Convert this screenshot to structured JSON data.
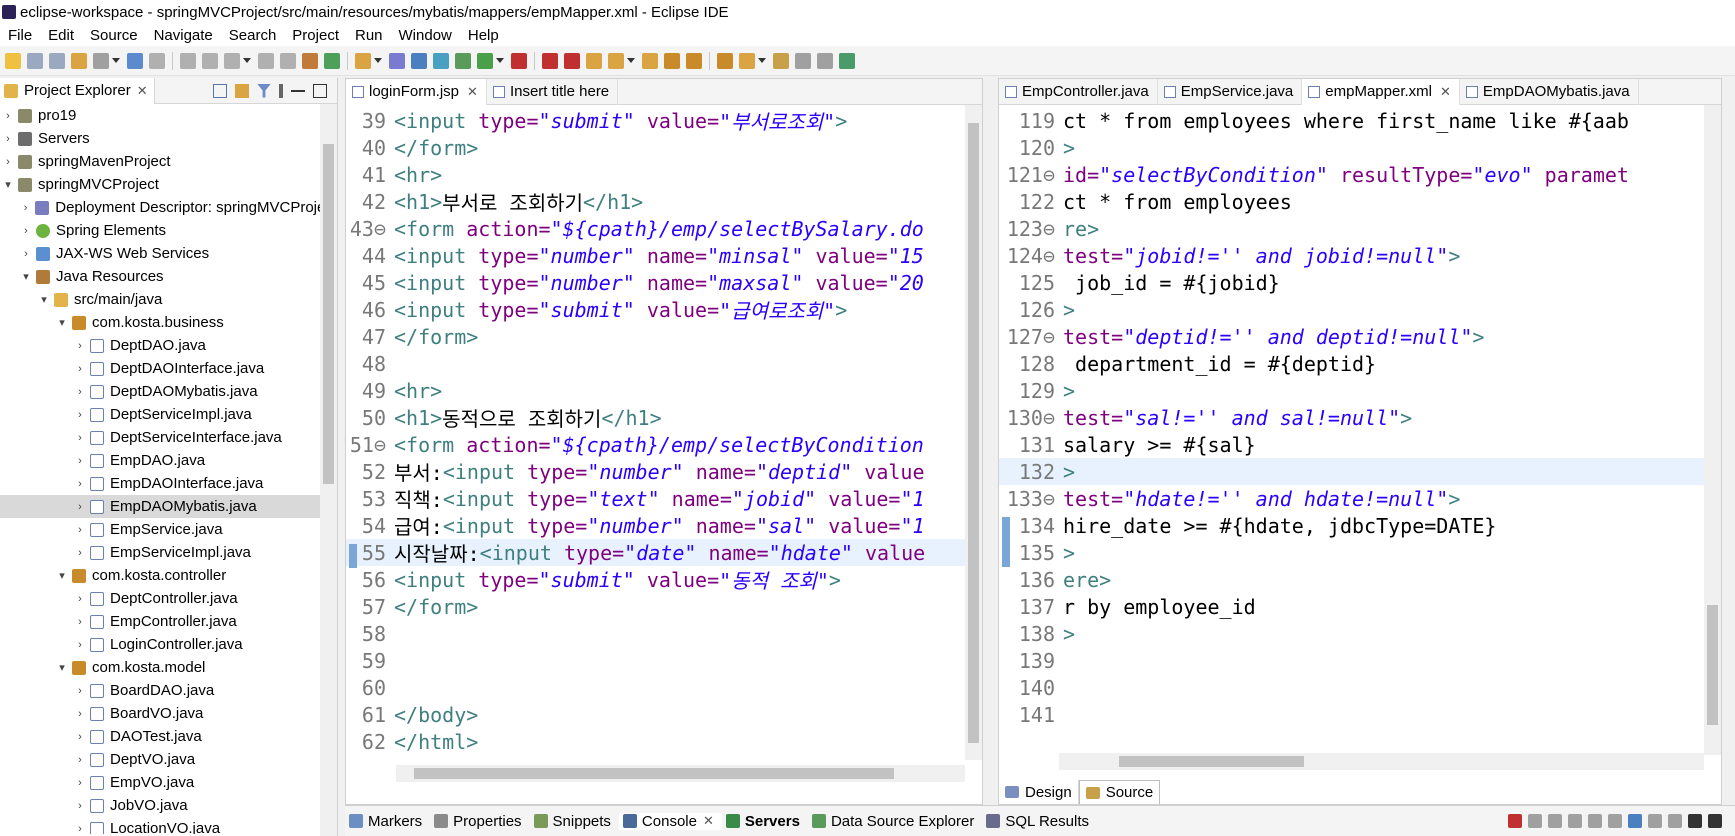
{
  "window": {
    "title": "eclipse-workspace - springMVCProject/src/main/resources/mybatis/mappers/empMapper.xml - Eclipse IDE"
  },
  "menu": [
    "File",
    "Edit",
    "Source",
    "Navigate",
    "Search",
    "Project",
    "Run",
    "Window",
    "Help"
  ],
  "project_explorer": {
    "tab_label": "Project Explorer",
    "items": [
      {
        "label": "pro19",
        "icon": "project-icon",
        "depth": 0,
        "chev": "›"
      },
      {
        "label": "Servers",
        "icon": "folder-icon",
        "depth": 0,
        "chev": "›"
      },
      {
        "label": "springMavenProject",
        "icon": "project-icon",
        "depth": 0,
        "chev": "›"
      },
      {
        "label": "springMVCProject",
        "icon": "project-icon",
        "depth": 0,
        "chev": "⌄"
      },
      {
        "label": "Deployment Descriptor: springMVCProject",
        "icon": "deployment-descriptor-icon",
        "depth": 1,
        "chev": "›"
      },
      {
        "label": "Spring Elements",
        "icon": "spring-icon",
        "depth": 1,
        "chev": "›"
      },
      {
        "label": "JAX-WS Web Services",
        "icon": "webservice-icon",
        "depth": 1,
        "chev": "›"
      },
      {
        "label": "Java Resources",
        "icon": "java-resources-icon",
        "depth": 1,
        "chev": "⌄"
      },
      {
        "label": "src/main/java",
        "icon": "source-folder-icon",
        "depth": 2,
        "chev": "⌄"
      },
      {
        "label": "com.kosta.business",
        "icon": "package-icon",
        "depth": 3,
        "chev": "⌄"
      },
      {
        "label": "DeptDAO.java",
        "icon": "java-file-icon",
        "depth": 4,
        "chev": "›"
      },
      {
        "label": "DeptDAOInterface.java",
        "icon": "java-file-icon",
        "depth": 4,
        "chev": "›"
      },
      {
        "label": "DeptDAOMybatis.java",
        "icon": "java-file-icon",
        "depth": 4,
        "chev": "›"
      },
      {
        "label": "DeptServiceImpl.java",
        "icon": "java-file-icon",
        "depth": 4,
        "chev": "›"
      },
      {
        "label": "DeptServiceInterface.java",
        "icon": "java-file-icon",
        "depth": 4,
        "chev": "›"
      },
      {
        "label": "EmpDAO.java",
        "icon": "java-file-icon",
        "depth": 4,
        "chev": "›"
      },
      {
        "label": "EmpDAOInterface.java",
        "icon": "java-file-icon",
        "depth": 4,
        "chev": "›"
      },
      {
        "label": "EmpDAOMybatis.java",
        "icon": "java-file-icon",
        "depth": 4,
        "chev": "›",
        "selected": true
      },
      {
        "label": "EmpService.java",
        "icon": "java-file-icon",
        "depth": 4,
        "chev": "›"
      },
      {
        "label": "EmpServiceImpl.java",
        "icon": "java-file-icon",
        "depth": 4,
        "chev": "›"
      },
      {
        "label": "com.kosta.controller",
        "icon": "package-icon",
        "depth": 3,
        "chev": "⌄"
      },
      {
        "label": "DeptController.java",
        "icon": "java-file-icon",
        "depth": 4,
        "chev": "›"
      },
      {
        "label": "EmpController.java",
        "icon": "java-file-icon",
        "depth": 4,
        "chev": "›"
      },
      {
        "label": "LoginController.java",
        "icon": "java-file-icon",
        "depth": 4,
        "chev": "›"
      },
      {
        "label": "com.kosta.model",
        "icon": "package-icon",
        "depth": 3,
        "chev": "⌄"
      },
      {
        "label": "BoardDAO.java",
        "icon": "java-file-icon",
        "depth": 4,
        "chev": "›"
      },
      {
        "label": "BoardVO.java",
        "icon": "java-file-icon",
        "depth": 4,
        "chev": "›"
      },
      {
        "label": "DAOTest.java",
        "icon": "java-file-icon",
        "depth": 4,
        "chev": "›"
      },
      {
        "label": "DeptVO.java",
        "icon": "java-file-icon",
        "depth": 4,
        "chev": "›"
      },
      {
        "label": "EmpVO.java",
        "icon": "java-file-icon",
        "depth": 4,
        "chev": "›"
      },
      {
        "label": "JobVO.java",
        "icon": "java-file-icon",
        "depth": 4,
        "chev": "›"
      },
      {
        "label": "LocationVO.java",
        "icon": "java-file-icon",
        "depth": 4,
        "chev": "›"
      }
    ]
  },
  "left_editor": {
    "tabs": [
      {
        "label": "loginForm.jsp",
        "active": true,
        "closable": true
      },
      {
        "label": "Insert title here",
        "active": false,
        "closable": false
      }
    ],
    "lines": [
      {
        "n": "39",
        "tokens": [
          [
            "tag",
            "<input "
          ],
          [
            "attr",
            "type="
          ],
          [
            "str",
            "\"submit\""
          ],
          [
            "attr",
            " value="
          ],
          [
            "str",
            "\"부서로조회\""
          ],
          [
            "tag",
            ">"
          ]
        ]
      },
      {
        "n": "40",
        "tokens": [
          [
            "tag",
            "</form>"
          ]
        ]
      },
      {
        "n": "41",
        "tokens": [
          [
            "tag",
            "<hr>"
          ]
        ]
      },
      {
        "n": "42",
        "tokens": [
          [
            "tag",
            "<h1>"
          ],
          [
            "txt",
            "부서로 조회하기"
          ],
          [
            "tag",
            "</h1>"
          ]
        ]
      },
      {
        "n": "43⊖",
        "tokens": [
          [
            "tag",
            "<form "
          ],
          [
            "attr",
            "action="
          ],
          [
            "str",
            "\"${cpath}/emp/selectBySalary.do"
          ]
        ]
      },
      {
        "n": "44",
        "tokens": [
          [
            "tag",
            "<input "
          ],
          [
            "attr",
            "type="
          ],
          [
            "str",
            "\"number\""
          ],
          [
            "attr",
            " name="
          ],
          [
            "str",
            "\"minsal\""
          ],
          [
            "attr",
            " value="
          ],
          [
            "str",
            "\"15"
          ]
        ]
      },
      {
        "n": "45",
        "tokens": [
          [
            "tag",
            "<input "
          ],
          [
            "attr",
            "type="
          ],
          [
            "str",
            "\"number\""
          ],
          [
            "attr",
            " name="
          ],
          [
            "str",
            "\"maxsal\""
          ],
          [
            "attr",
            " value="
          ],
          [
            "str",
            "\"20"
          ]
        ]
      },
      {
        "n": "46",
        "tokens": [
          [
            "tag",
            "<input "
          ],
          [
            "attr",
            "type="
          ],
          [
            "str",
            "\"submit\""
          ],
          [
            "attr",
            " value="
          ],
          [
            "str",
            "\"급여로조회\""
          ],
          [
            "tag",
            ">"
          ]
        ]
      },
      {
        "n": "47",
        "tokens": [
          [
            "tag",
            "</form>"
          ]
        ]
      },
      {
        "n": "48",
        "tokens": []
      },
      {
        "n": "49",
        "tokens": [
          [
            "tag",
            "<hr>"
          ]
        ]
      },
      {
        "n": "50",
        "tokens": [
          [
            "tag",
            "<h1>"
          ],
          [
            "txt",
            "동적으로 조회하기"
          ],
          [
            "tag",
            "</h1>"
          ]
        ]
      },
      {
        "n": "51⊖",
        "tokens": [
          [
            "tag",
            "<form "
          ],
          [
            "attr",
            "action="
          ],
          [
            "str",
            "\"${cpath}/emp/selectByCondition"
          ]
        ]
      },
      {
        "n": "52",
        "tokens": [
          [
            "txt",
            "부서:"
          ],
          [
            "tag",
            "<input "
          ],
          [
            "attr",
            "type="
          ],
          [
            "str",
            "\"number\""
          ],
          [
            "attr",
            " name="
          ],
          [
            "str",
            "\"deptid\""
          ],
          [
            "attr",
            " value"
          ]
        ]
      },
      {
        "n": "53",
        "tokens": [
          [
            "txt",
            "직책:"
          ],
          [
            "tag",
            "<input "
          ],
          [
            "attr",
            "type="
          ],
          [
            "str",
            "\"text\""
          ],
          [
            "attr",
            " name="
          ],
          [
            "str",
            "\"jobid\""
          ],
          [
            "attr",
            " value="
          ],
          [
            "str",
            "\"1"
          ]
        ]
      },
      {
        "n": "54",
        "tokens": [
          [
            "txt",
            "급여:"
          ],
          [
            "tag",
            "<input "
          ],
          [
            "attr",
            "type="
          ],
          [
            "str",
            "\"number\""
          ],
          [
            "attr",
            " name="
          ],
          [
            "str",
            "\"sal\""
          ],
          [
            "attr",
            " value="
          ],
          [
            "str",
            "\"1"
          ]
        ]
      },
      {
        "n": "55",
        "tokens": [
          [
            "txt",
            "시작날짜:"
          ],
          [
            "tag",
            "<input "
          ],
          [
            "attr",
            "type="
          ],
          [
            "str",
            "\"date\""
          ],
          [
            "attr",
            " name="
          ],
          [
            "str",
            "\"hdate\""
          ],
          [
            "attr",
            " value"
          ]
        ],
        "current": true
      },
      {
        "n": "56",
        "tokens": [
          [
            "tag",
            "<input "
          ],
          [
            "attr",
            "type="
          ],
          [
            "str",
            "\"submit\""
          ],
          [
            "attr",
            " value="
          ],
          [
            "str",
            "\"동적 조회\""
          ],
          [
            "tag",
            ">"
          ]
        ]
      },
      {
        "n": "57",
        "tokens": [
          [
            "tag",
            "</form>"
          ]
        ]
      },
      {
        "n": "58",
        "tokens": []
      },
      {
        "n": "59",
        "tokens": []
      },
      {
        "n": "60",
        "tokens": []
      },
      {
        "n": "61",
        "tokens": [
          [
            "tag",
            "</body>"
          ]
        ]
      },
      {
        "n": "62",
        "tokens": [
          [
            "tag",
            "</html>"
          ]
        ]
      }
    ]
  },
  "right_editor": {
    "tabs": [
      {
        "label": "EmpController.java",
        "active": false,
        "closable": false
      },
      {
        "label": "EmpService.java",
        "active": false,
        "closable": false
      },
      {
        "label": "empMapper.xml",
        "active": true,
        "closable": true
      },
      {
        "label": "EmpDAOMybatis.java",
        "active": false,
        "closable": false
      }
    ],
    "lines": [
      {
        "n": "119",
        "tokens": [
          [
            "txt",
            "ct * from employees where first_name like #{aab"
          ]
        ]
      },
      {
        "n": "120",
        "tokens": [
          [
            "tag",
            ">"
          ]
        ]
      },
      {
        "n": "121⊖",
        "tokens": [
          [
            "attr",
            "id="
          ],
          [
            "str",
            "\"selectByCondition\""
          ],
          [
            "attr",
            " resultType="
          ],
          [
            "str",
            "\"evo\""
          ],
          [
            "attr",
            " paramet"
          ]
        ]
      },
      {
        "n": "122",
        "tokens": [
          [
            "txt",
            "ct * from employees"
          ]
        ]
      },
      {
        "n": "123⊖",
        "tokens": [
          [
            "tag",
            "re>"
          ]
        ]
      },
      {
        "n": "124⊖",
        "tokens": [
          [
            "attr",
            "test="
          ],
          [
            "str",
            "\"jobid!='' and jobid!=null\""
          ],
          [
            "tag",
            ">"
          ]
        ]
      },
      {
        "n": "125",
        "tokens": [
          [
            "txt",
            " job_id = #{jobid}"
          ]
        ]
      },
      {
        "n": "126",
        "tokens": [
          [
            "tag",
            ">"
          ]
        ]
      },
      {
        "n": "127⊖",
        "tokens": [
          [
            "attr",
            "test="
          ],
          [
            "str",
            "\"deptid!='' and deptid!=null\""
          ],
          [
            "tag",
            ">"
          ]
        ]
      },
      {
        "n": "128",
        "tokens": [
          [
            "txt",
            " department_id = #{deptid}"
          ]
        ]
      },
      {
        "n": "129",
        "tokens": [
          [
            "tag",
            ">"
          ]
        ]
      },
      {
        "n": "130⊖",
        "tokens": [
          [
            "attr",
            "test="
          ],
          [
            "str",
            "\"sal!='' and sal!=null\""
          ],
          [
            "tag",
            ">"
          ]
        ]
      },
      {
        "n": "131",
        "tokens": [
          [
            "txt",
            "salary >= #{sal}"
          ]
        ]
      },
      {
        "n": "132",
        "tokens": [
          [
            "tag",
            ">"
          ]
        ],
        "current": true
      },
      {
        "n": "133⊖",
        "tokens": [
          [
            "attr",
            "test="
          ],
          [
            "str",
            "\"hdate!='' and hdate!=null\""
          ],
          [
            "tag",
            ">"
          ]
        ]
      },
      {
        "n": "134",
        "tokens": [
          [
            "txt",
            "hire_date >= #{hdate, jdbcType=DATE}"
          ]
        ]
      },
      {
        "n": "135",
        "tokens": [
          [
            "tag",
            ">"
          ]
        ]
      },
      {
        "n": "136",
        "tokens": [
          [
            "tag",
            "ere>"
          ]
        ]
      },
      {
        "n": "137",
        "tokens": [
          [
            "txt",
            "r by employee_id"
          ]
        ]
      },
      {
        "n": "138",
        "tokens": [
          [
            "tag",
            ">"
          ]
        ]
      },
      {
        "n": "139",
        "tokens": []
      },
      {
        "n": "140",
        "tokens": []
      },
      {
        "n": "141",
        "tokens": []
      }
    ],
    "design_tab": "Design",
    "source_tab": "Source"
  },
  "bottom_tabs": [
    {
      "label": "Markers",
      "icon": "markers-icon"
    },
    {
      "label": "Properties",
      "icon": "properties-icon"
    },
    {
      "label": "Snippets",
      "icon": "snippets-icon"
    },
    {
      "label": "Console",
      "icon": "console-icon",
      "active": true,
      "closable": true
    },
    {
      "label": "Servers",
      "icon": "servers-icon",
      "bold": true
    },
    {
      "label": "Data Source Explorer",
      "icon": "data-source-icon"
    },
    {
      "label": "SQL Results",
      "icon": "sql-results-icon"
    }
  ],
  "colors": {
    "xml_tag": "#3f7f7f",
    "xml_attr": "#7f007f",
    "xml_string": "#2a00ff",
    "current_line": "#e8f2fe",
    "selection": "#d9d9d9"
  }
}
